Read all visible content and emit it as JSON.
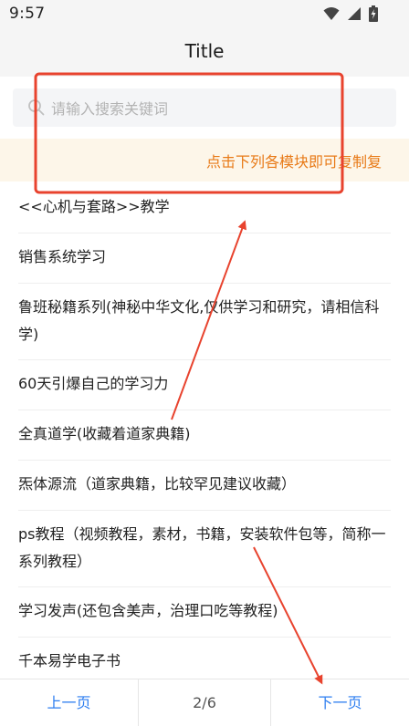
{
  "status_bar": {
    "time": "9:57",
    "icons": [
      "wifi-icon",
      "cellular-signal-icon",
      "battery-charging-icon"
    ]
  },
  "header": {
    "title": "Title"
  },
  "search": {
    "placeholder": "请输入搜索关键词",
    "value": ""
  },
  "notice": {
    "text": "点击下列各模块即可复制复"
  },
  "list": {
    "items": [
      "<<心机与套路>>教学",
      "销售系统学习",
      "鲁班秘籍系列(神秘中华文化,仅供学习和研究，请相信科学)",
      "60天引爆自己的学习力",
      "全真道学(收藏着道家典籍)",
      "炁体源流（道家典籍，比较罕见建议收藏）",
      "ps教程（视频教程，素材，书籍，安装软件包等，简称一系列教程）",
      "学习发声(还包含美声，治理口吃等教程)",
      "千本易学电子书"
    ]
  },
  "pager": {
    "prev_label": "上一页",
    "indicator": "2/6",
    "next_label": "下一页"
  },
  "colors": {
    "accent": "#2d7ef0",
    "notice_text": "#e87a17",
    "notice_bg": "#fdf6e9",
    "annotation_red": "#e8432e"
  }
}
